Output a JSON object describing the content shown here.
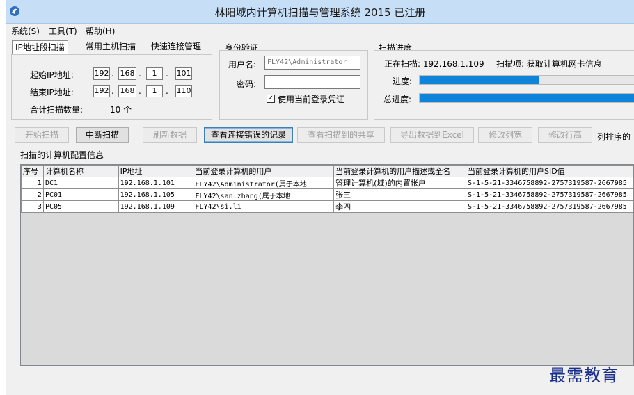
{
  "window": {
    "title": "林阳域内计算机扫描与管理系统 2015 已注册"
  },
  "menu": {
    "system": "系统(S)",
    "tools": "工具(T)",
    "help": "帮助(H)"
  },
  "tabs": [
    {
      "label": "IP地址段扫描",
      "active": true
    },
    {
      "label": "常用主机扫描",
      "active": false
    },
    {
      "label": "快速连接管理",
      "active": false
    }
  ],
  "ip_range": {
    "start_label": "起始IP地址:",
    "start_ip": [
      "192",
      "168",
      "1",
      "101"
    ],
    "end_label": "结束IP地址:",
    "end_ip": [
      "192",
      "168",
      "1",
      "110"
    ],
    "total_label": "合计扫描数量:",
    "total_value": "10 个"
  },
  "auth": {
    "group_title": "身份验证",
    "username_label": "用户名:",
    "username_value": "FLY42\\Administrator",
    "password_label": "密码:",
    "password_value": "",
    "use_current_label": "使用当前登录凭证",
    "use_current_checked": true
  },
  "progress": {
    "group_title": "扫描进度",
    "scanning_label": "正在扫描: 192.168.1.109",
    "scan_item_label": "扫描项: 获取计算机网卡信息",
    "item_progress_label": "进度:",
    "item_progress_percent": 55,
    "total_progress_label": "总进度:",
    "total_progress_percent": 100
  },
  "toolbar": {
    "start_scan": "开始扫描",
    "stop_scan": "中断扫描",
    "refresh": "刷新数据",
    "view_errors": "查看连接错误的记录",
    "view_shares": "查看扫描到的共享",
    "export_excel": "导出数据到Excel",
    "edit_col_width": "修改列宽",
    "edit_row_height": "修改行高",
    "sort_label": "列排序的"
  },
  "grid": {
    "section_title": "扫描的计算机配置信息",
    "columns": [
      "序号",
      "计算机名称",
      "IP地址",
      "当前登录计算机的用户",
      "当前登录计算机的用户描述或全名",
      "当前登录计算机的用户SID值"
    ],
    "rows": [
      [
        "1",
        "DC1",
        "192.168.1.101",
        "FLY42\\Administrator(属于本地",
        "管理计算机(域)的内置帐户",
        "S-1-5-21-3346758892-2757319587-2667985"
      ],
      [
        "2",
        "PC01",
        "192.168.1.105",
        "FLY42\\san.zhang(属于本地",
        "张三",
        "S-1-5-21-3346758892-2757319587-2667985"
      ],
      [
        "3",
        "PC05",
        "192.168.1.109",
        "FLY42\\si.li",
        "李四",
        "S-1-5-21-3346758892-2757319587-2667985"
      ]
    ]
  },
  "watermark": "最需教育",
  "colors": {
    "titlebar": "#c6dff6",
    "progress_fill": "#0d83da",
    "watermark": "#1a2f8a"
  }
}
